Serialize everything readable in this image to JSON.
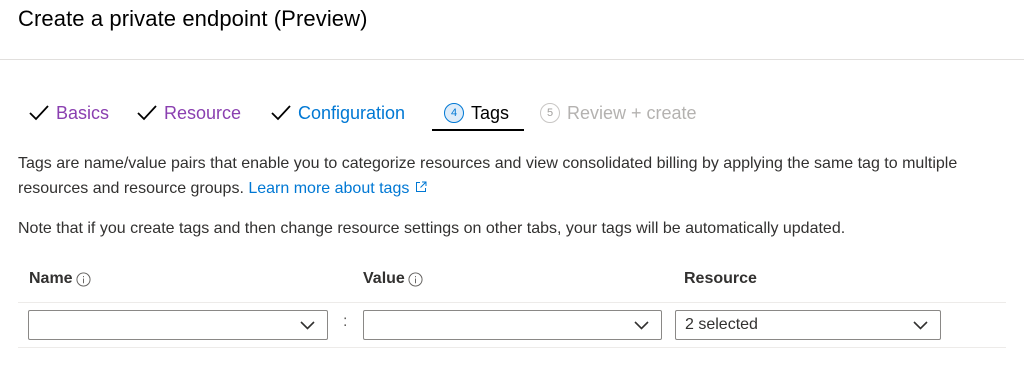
{
  "page": {
    "title": "Create a private endpoint (Preview)"
  },
  "tabs": [
    {
      "label": "Basics",
      "state": "done"
    },
    {
      "label": "Resource",
      "state": "done"
    },
    {
      "label": "Configuration",
      "state": "done"
    },
    {
      "step": "4",
      "label": "Tags",
      "state": "active"
    },
    {
      "step": "5",
      "label": "Review + create",
      "state": "disabled"
    }
  ],
  "description": {
    "text": "Tags are name/value pairs that enable you to categorize resources and view consolidated billing by applying the same tag to multiple resources and resource groups.",
    "link_label": "Learn more about tags",
    "link_icon": "external-link-icon"
  },
  "note": "Note that if you create tags and then change resource settings on other tabs, your tags will be automatically updated.",
  "table": {
    "columns": {
      "name": "Name",
      "value": "Value",
      "resource": "Resource"
    },
    "info_icon": "info-icon",
    "row": {
      "name_value": "",
      "separator": ":",
      "value_value": "",
      "resource_value": "2 selected"
    }
  },
  "colors": {
    "accent": "#0078d4",
    "completed_tab": "#8a3fb0",
    "disabled": "#b4b2b0"
  }
}
